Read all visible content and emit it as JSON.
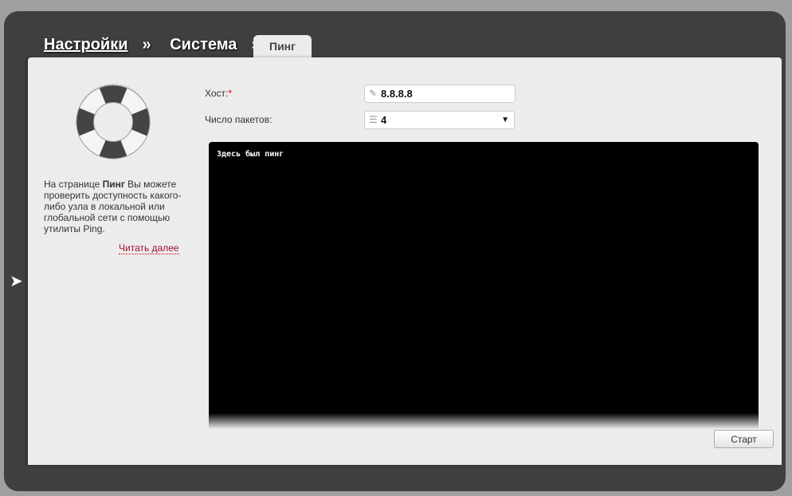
{
  "breadcrumb": {
    "settings": "Настройки",
    "sep1": "»",
    "system": "Система",
    "sep2": "»"
  },
  "tab": {
    "label": "Пинг"
  },
  "sidebar": {
    "desc_pre": "На странице ",
    "desc_bold": "Пинг",
    "desc_post": " Вы можете проверить доступность какого-либо узла в локальной или глобальной сети с помощью утилиты Ping.",
    "read_more": "Читать далее",
    "back_icon": "‹"
  },
  "form": {
    "host_label": "Хост:",
    "required": "*",
    "host_value": "8.8.8.8",
    "packets_label": "Число пакетов:",
    "packets_value": "4"
  },
  "terminal": {
    "output": "Здесь был пинг"
  },
  "actions": {
    "start": "Старт"
  }
}
